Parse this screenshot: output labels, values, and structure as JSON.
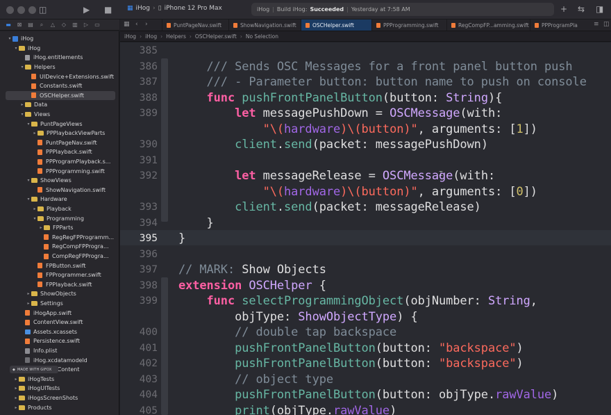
{
  "titlebar": {
    "scheme_project": "iHog",
    "scheme_device": "iPhone 12 Pro Max",
    "status_project": "iHog",
    "status_action": "Build iHog:",
    "status_result": "Succeeded",
    "status_time": "Yesterday at 7:58 AM"
  },
  "tabs": [
    {
      "label": "PuntPageNav.swift",
      "active": false
    },
    {
      "label": "ShowNavigation.swift",
      "active": false
    },
    {
      "label": "OSCHelper.swift",
      "active": true
    },
    {
      "label": "PPProgramming.swift",
      "active": false
    },
    {
      "label": "RegCompFP...amming.swift",
      "active": false
    },
    {
      "label": "PPProgramPla",
      "active": false
    }
  ],
  "jumpbar": [
    "iHog",
    "iHog",
    "Helpers",
    "OSCHelper.swift",
    "No Selection"
  ],
  "navigator": [
    {
      "label": "iHog",
      "indent": 0,
      "icon": "proj",
      "disc": "▾"
    },
    {
      "label": "iHog",
      "indent": 1,
      "icon": "folder",
      "disc": "▾"
    },
    {
      "label": "iHog.entitlements",
      "indent": 2,
      "icon": "ent",
      "disc": ""
    },
    {
      "label": "Helpers",
      "indent": 2,
      "icon": "folder",
      "disc": "▾"
    },
    {
      "label": "UIDevice+Extensions.swift",
      "indent": 3,
      "icon": "swift",
      "disc": ""
    },
    {
      "label": "Constants.swift",
      "indent": 3,
      "icon": "swift",
      "disc": ""
    },
    {
      "label": "OSCHelper.swift",
      "indent": 3,
      "icon": "swift",
      "disc": "",
      "selected": true
    },
    {
      "label": "Data",
      "indent": 2,
      "icon": "folder",
      "disc": "▸"
    },
    {
      "label": "Views",
      "indent": 2,
      "icon": "folder",
      "disc": "▾"
    },
    {
      "label": "PuntPageViews",
      "indent": 3,
      "icon": "folder",
      "disc": "▾"
    },
    {
      "label": "PPPlaybackViewParts",
      "indent": 4,
      "icon": "folder",
      "disc": "▸"
    },
    {
      "label": "PuntPageNav.swift",
      "indent": 4,
      "icon": "swift",
      "disc": ""
    },
    {
      "label": "PPPlayback.swift",
      "indent": 4,
      "icon": "swift",
      "disc": ""
    },
    {
      "label": "PPProgramPlayback.s...",
      "indent": 4,
      "icon": "swift",
      "disc": ""
    },
    {
      "label": "PPProgramming.swift",
      "indent": 4,
      "icon": "swift",
      "disc": ""
    },
    {
      "label": "ShowViews",
      "indent": 3,
      "icon": "folder",
      "disc": "▾"
    },
    {
      "label": "ShowNavigation.swift",
      "indent": 4,
      "icon": "swift",
      "disc": ""
    },
    {
      "label": "Hardware",
      "indent": 3,
      "icon": "folder",
      "disc": "▾"
    },
    {
      "label": "Playback",
      "indent": 4,
      "icon": "folder",
      "disc": "▸"
    },
    {
      "label": "Programming",
      "indent": 4,
      "icon": "folder",
      "disc": "▾"
    },
    {
      "label": "FPParts",
      "indent": 5,
      "icon": "folder",
      "disc": "▸"
    },
    {
      "label": "RegRegFPProgramm...",
      "indent": 5,
      "icon": "swift",
      "disc": ""
    },
    {
      "label": "RegCompFPProgra...",
      "indent": 5,
      "icon": "swift",
      "disc": ""
    },
    {
      "label": "CompRegFPProgra...",
      "indent": 5,
      "icon": "swift",
      "disc": ""
    },
    {
      "label": "FPButton.swift",
      "indent": 4,
      "icon": "swift",
      "disc": ""
    },
    {
      "label": "FPProgrammer.swift",
      "indent": 4,
      "icon": "swift",
      "disc": ""
    },
    {
      "label": "FPPlayback.swift",
      "indent": 4,
      "icon": "swift",
      "disc": ""
    },
    {
      "label": "ShowObjects",
      "indent": 3,
      "icon": "folder",
      "disc": "▸"
    },
    {
      "label": "Settings",
      "indent": 3,
      "icon": "folder",
      "disc": "▸"
    },
    {
      "label": "iHogApp.swift",
      "indent": 2,
      "icon": "swift",
      "disc": ""
    },
    {
      "label": "ContentView.swift",
      "indent": 2,
      "icon": "swift",
      "disc": ""
    },
    {
      "label": "Assets.xcassets",
      "indent": 2,
      "icon": "assets",
      "disc": ""
    },
    {
      "label": "Persistence.swift",
      "indent": 2,
      "icon": "swift",
      "disc": ""
    },
    {
      "label": "Info.plist",
      "indent": 2,
      "icon": "plist",
      "disc": ""
    },
    {
      "label": "iHog.xcdatamodeld",
      "indent": 2,
      "icon": "xcd",
      "disc": ""
    },
    {
      "label": "Preview Content",
      "indent": 2,
      "icon": "folder",
      "disc": "▸"
    },
    {
      "label": "iHogTests",
      "indent": 1,
      "icon": "folder",
      "disc": "▸"
    },
    {
      "label": "iHogUITests",
      "indent": 1,
      "icon": "folder",
      "disc": "▸"
    },
    {
      "label": "iHogsScreenShots",
      "indent": 1,
      "icon": "folder",
      "disc": "▸"
    },
    {
      "label": "Products",
      "indent": 1,
      "icon": "folder",
      "disc": "▸"
    }
  ],
  "gifox_badge": "MADE WITH GIFOX",
  "editor": {
    "current_line": "395",
    "lines": [
      {
        "n": "385",
        "tokens": []
      },
      {
        "n": "386",
        "tokens": [
          [
            "cm",
            "    /// Sends OSC Messages for a front panel button push"
          ]
        ]
      },
      {
        "n": "387",
        "tokens": [
          [
            "cm",
            "    /// - Parameter button: button name to push on console"
          ]
        ]
      },
      {
        "n": "388",
        "tokens": [
          [
            "kw",
            "    func "
          ],
          [
            "fn",
            "pushFrontPanelButton"
          ],
          [
            "",
            "(button: "
          ],
          [
            "ty",
            "String"
          ],
          [
            "",
            "){"
          ]
        ]
      },
      {
        "n": "389",
        "tokens": [
          [
            "kw",
            "        let "
          ],
          [
            "",
            "messagePushDown = "
          ],
          [
            "ty",
            "OSCMessage"
          ],
          [
            "",
            "(with:"
          ]
        ]
      },
      {
        "n": "",
        "tokens": [
          [
            "str",
            "            \"\\("
          ],
          [
            "prop",
            "hardware"
          ],
          [
            "str",
            ")\\(button)\""
          ],
          [
            "",
            ", arguments: ["
          ],
          [
            "num",
            "1"
          ],
          [
            "",
            "])"
          ]
        ]
      },
      {
        "n": "390",
        "tokens": [
          [
            "fn",
            "        client"
          ],
          [
            "",
            "."
          ],
          [
            "fn",
            "send"
          ],
          [
            "",
            "(packet: messagePushDown)"
          ]
        ]
      },
      {
        "n": "391",
        "tokens": []
      },
      {
        "n": "392",
        "tokens": [
          [
            "kw",
            "        let "
          ],
          [
            "",
            "messageRelease = "
          ],
          [
            "ty",
            "OSCMessage"
          ],
          [
            "",
            "(with:"
          ]
        ]
      },
      {
        "n": "",
        "tokens": [
          [
            "str",
            "            \"\\("
          ],
          [
            "prop",
            "hardware"
          ],
          [
            "str",
            ")\\(button)\""
          ],
          [
            "",
            ", arguments: ["
          ],
          [
            "num",
            "0"
          ],
          [
            "",
            "])"
          ]
        ]
      },
      {
        "n": "393",
        "tokens": [
          [
            "fn",
            "        client"
          ],
          [
            "",
            "."
          ],
          [
            "fn",
            "send"
          ],
          [
            "",
            "(packet: messageRelease)"
          ]
        ]
      },
      {
        "n": "394",
        "tokens": [
          [
            "",
            "    }"
          ]
        ]
      },
      {
        "n": "395",
        "tokens": [
          [
            "",
            "}"
          ]
        ]
      },
      {
        "n": "396",
        "tokens": []
      },
      {
        "n": "397",
        "tokens": [
          [
            "mark",
            "// MARK: "
          ],
          [
            "",
            "Show Objects"
          ]
        ]
      },
      {
        "n": "398",
        "tokens": [
          [
            "kw",
            "extension "
          ],
          [
            "ty",
            "OSCHelper"
          ],
          [
            "",
            " {"
          ]
        ]
      },
      {
        "n": "399",
        "tokens": [
          [
            "kw",
            "    func "
          ],
          [
            "fn",
            "selectProgrammingObject"
          ],
          [
            "",
            "(objNumber: "
          ],
          [
            "ty",
            "String"
          ],
          [
            "",
            ","
          ]
        ]
      },
      {
        "n": "",
        "tokens": [
          [
            "",
            "        objType: "
          ],
          [
            "ty",
            "ShowObjectType"
          ],
          [
            "",
            ") {"
          ]
        ]
      },
      {
        "n": "400",
        "tokens": [
          [
            "cm",
            "        // double tap backspace"
          ]
        ]
      },
      {
        "n": "401",
        "tokens": [
          [
            "fn",
            "        pushFrontPanelButton"
          ],
          [
            "",
            "(button: "
          ],
          [
            "str",
            "\"backspace\""
          ],
          [
            "",
            ")"
          ]
        ]
      },
      {
        "n": "402",
        "tokens": [
          [
            "fn",
            "        pushFrontPanelButton"
          ],
          [
            "",
            "(button: "
          ],
          [
            "str",
            "\"backspace\""
          ],
          [
            "",
            ")"
          ]
        ]
      },
      {
        "n": "403",
        "tokens": [
          [
            "cm",
            "        // object type"
          ]
        ]
      },
      {
        "n": "404",
        "tokens": [
          [
            "fn",
            "        pushFrontPanelButton"
          ],
          [
            "",
            "(button: objType."
          ],
          [
            "prop",
            "rawValue"
          ],
          [
            "",
            ")"
          ]
        ]
      },
      {
        "n": "405",
        "tokens": [
          [
            "fn",
            "        print"
          ],
          [
            "",
            "(objType."
          ],
          [
            "prop",
            "rawValue"
          ],
          [
            "",
            ")"
          ]
        ]
      }
    ]
  }
}
